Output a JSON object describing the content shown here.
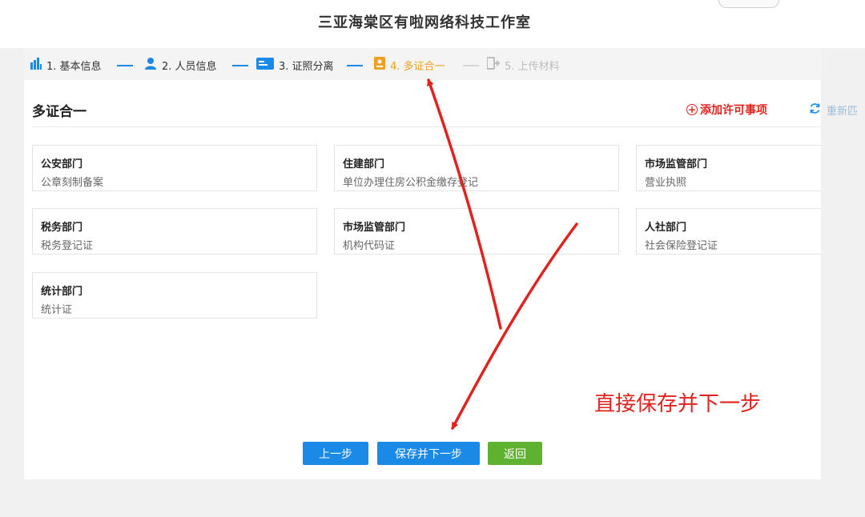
{
  "header": {
    "title": "三亚海棠区有啦网络科技工作室"
  },
  "steps": [
    {
      "label": "1. 基本信息",
      "status": "done",
      "icon": "bar-chart-icon"
    },
    {
      "label": "2. 人员信息",
      "status": "done",
      "icon": "person-icon"
    },
    {
      "label": "3. 证照分离",
      "status": "done",
      "icon": "card-icon"
    },
    {
      "label": "4. 多证合一",
      "status": "active",
      "icon": "document-icon"
    },
    {
      "label": "5. 上传材料",
      "status": "todo",
      "icon": "upload-icon"
    }
  ],
  "section": {
    "title": "多证合一",
    "add_label": "添加许可事项",
    "rematch_label": "重新匹"
  },
  "cards": [
    {
      "dept": "公安部门",
      "permit": "公章刻制备案"
    },
    {
      "dept": "住建部门",
      "permit": "单位办理住房公积金缴存登记"
    },
    {
      "dept": "市场监管部门",
      "permit": "营业执照"
    },
    {
      "dept": "税务部门",
      "permit": "税务登记证"
    },
    {
      "dept": "市场监管部门",
      "permit": "机构代码证"
    },
    {
      "dept": "人社部门",
      "permit": "社会保险登记证"
    },
    {
      "dept": "统计部门",
      "permit": "统计证"
    }
  ],
  "buttons": {
    "prev": "上一步",
    "save_next": "保存并下一步",
    "back": "返回"
  },
  "annotation": "直接保存并下一步",
  "colors": {
    "primary": "#1a8ae6",
    "active_step": "#f0a020",
    "danger": "#e0231e",
    "success": "#5fb130"
  }
}
